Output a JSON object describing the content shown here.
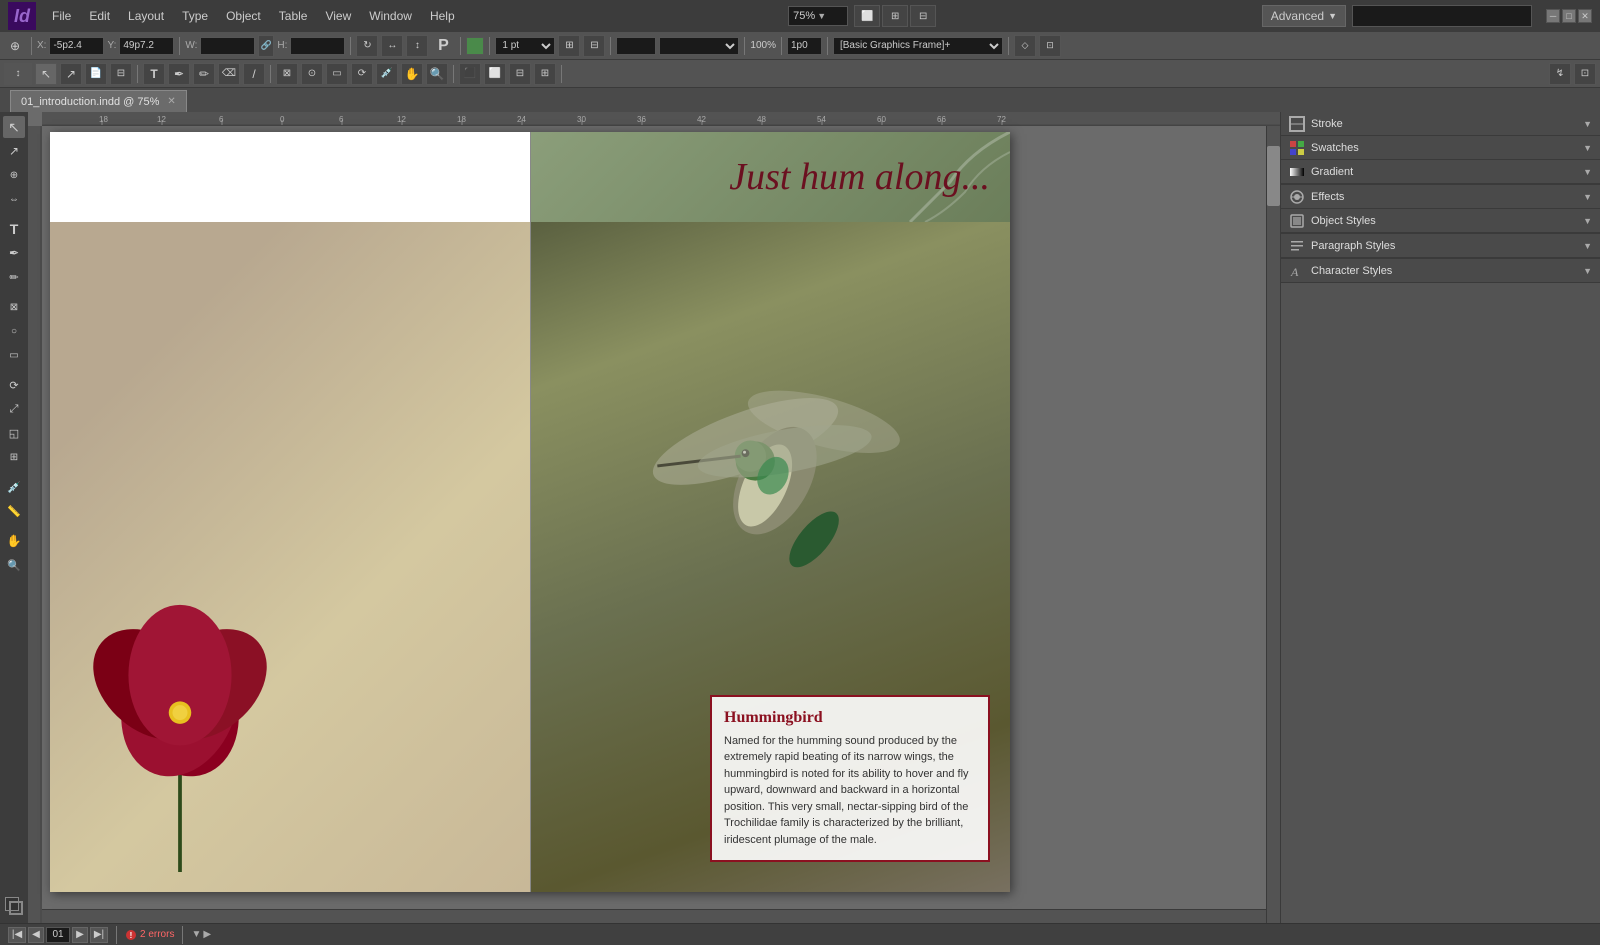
{
  "app": {
    "logo": "Id",
    "logo_color": "#9966cc"
  },
  "menu": {
    "items": [
      "File",
      "Edit",
      "Layout",
      "Type",
      "Object",
      "Table",
      "View",
      "Window",
      "Help"
    ],
    "zoom": "75%",
    "advanced_label": "Advanced",
    "search_placeholder": ""
  },
  "window_controls": {
    "minimize": "─",
    "maximize": "□",
    "close": "✕"
  },
  "toolbar1": {
    "x_label": "X:",
    "x_value": "-5p2.4",
    "y_label": "Y:",
    "y_value": "49p7.2",
    "w_label": "W:",
    "w_value": "",
    "h_label": "H:",
    "h_value": "",
    "stroke_weight": "1 pt",
    "opacity": "100%",
    "stroke_label": "1p0",
    "frame_type": "[Basic Graphics Frame]+"
  },
  "tab": {
    "filename": "01_introduction.indd",
    "zoom": "75%",
    "close_icon": "✕"
  },
  "document": {
    "header_title": "Just hum along...",
    "info_box": {
      "title": "Hummingbird",
      "body": "Named for the humming sound produced by the extremely rapid beating of its narrow wings, the hummingbird is noted for its ability to hover and fly upward, downward and backward in a horizontal position. This very small, nectar-sipping bird of the Trochilidае family is characterized by the brilliant, iridescent plumage of the male."
    }
  },
  "right_panels": {
    "stroke": {
      "title": "Stroke",
      "icon": "stroke"
    },
    "swatches": {
      "title": "Swatches",
      "icon": "swatches"
    },
    "gradient": {
      "title": "Gradient",
      "icon": "gradient"
    },
    "effects": {
      "title": "Effects",
      "icon": "effects"
    },
    "object_styles": {
      "title": "Object Styles",
      "icon": "object-styles"
    },
    "paragraph_styles": {
      "title": "Paragraph Styles",
      "icon": "paragraph-styles"
    },
    "character_styles": {
      "title": "Character Styles",
      "icon": "character-styles"
    }
  },
  "bottom_bar": {
    "page_indicator": "01",
    "errors_label": "2 errors",
    "arrow_left": "‹",
    "arrow_right": "›"
  }
}
